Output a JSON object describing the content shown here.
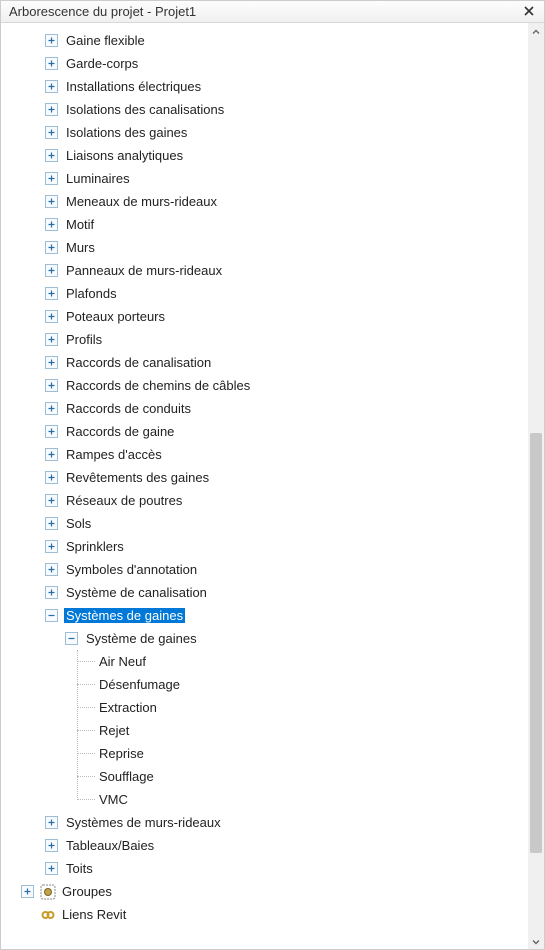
{
  "window": {
    "title": "Arborescence du projet - Projet1"
  },
  "tree": {
    "items": [
      {
        "label": "Gaine flexible",
        "depth": 2,
        "expander": "plus"
      },
      {
        "label": "Garde-corps",
        "depth": 2,
        "expander": "plus"
      },
      {
        "label": "Installations électriques",
        "depth": 2,
        "expander": "plus"
      },
      {
        "label": "Isolations des canalisations",
        "depth": 2,
        "expander": "plus"
      },
      {
        "label": "Isolations des gaines",
        "depth": 2,
        "expander": "plus"
      },
      {
        "label": "Liaisons analytiques",
        "depth": 2,
        "expander": "plus"
      },
      {
        "label": "Luminaires",
        "depth": 2,
        "expander": "plus"
      },
      {
        "label": "Meneaux de murs-rideaux",
        "depth": 2,
        "expander": "plus"
      },
      {
        "label": "Motif",
        "depth": 2,
        "expander": "plus"
      },
      {
        "label": "Murs",
        "depth": 2,
        "expander": "plus"
      },
      {
        "label": "Panneaux de murs-rideaux",
        "depth": 2,
        "expander": "plus"
      },
      {
        "label": "Plafonds",
        "depth": 2,
        "expander": "plus"
      },
      {
        "label": "Poteaux porteurs",
        "depth": 2,
        "expander": "plus"
      },
      {
        "label": "Profils",
        "depth": 2,
        "expander": "plus"
      },
      {
        "label": "Raccords de canalisation",
        "depth": 2,
        "expander": "plus"
      },
      {
        "label": "Raccords de chemins de câbles",
        "depth": 2,
        "expander": "plus"
      },
      {
        "label": "Raccords de conduits",
        "depth": 2,
        "expander": "plus"
      },
      {
        "label": "Raccords de gaine",
        "depth": 2,
        "expander": "plus"
      },
      {
        "label": "Rampes d'accès",
        "depth": 2,
        "expander": "plus"
      },
      {
        "label": "Revêtements des gaines",
        "depth": 2,
        "expander": "plus"
      },
      {
        "label": "Réseaux de poutres",
        "depth": 2,
        "expander": "plus"
      },
      {
        "label": "Sols",
        "depth": 2,
        "expander": "plus"
      },
      {
        "label": "Sprinklers",
        "depth": 2,
        "expander": "plus"
      },
      {
        "label": "Symboles d'annotation",
        "depth": 2,
        "expander": "plus"
      },
      {
        "label": "Système de canalisation",
        "depth": 2,
        "expander": "plus"
      },
      {
        "label": "Systèmes de gaines",
        "depth": 2,
        "expander": "minus",
        "selected": true
      },
      {
        "label": "Système de gaines",
        "depth": 3,
        "expander": "minus"
      },
      {
        "label": "Air Neuf",
        "depth": 4,
        "expander": "none"
      },
      {
        "label": "Désenfumage",
        "depth": 4,
        "expander": "none"
      },
      {
        "label": "Extraction",
        "depth": 4,
        "expander": "none"
      },
      {
        "label": "Rejet",
        "depth": 4,
        "expander": "none"
      },
      {
        "label": "Reprise",
        "depth": 4,
        "expander": "none"
      },
      {
        "label": "Soufflage",
        "depth": 4,
        "expander": "none"
      },
      {
        "label": "VMC",
        "depth": 4,
        "expander": "none"
      },
      {
        "label": "Systèmes de murs-rideaux",
        "depth": 2,
        "expander": "plus"
      },
      {
        "label": "Tableaux/Baies",
        "depth": 2,
        "expander": "plus"
      },
      {
        "label": "Toits",
        "depth": 2,
        "expander": "plus"
      },
      {
        "label": "Groupes",
        "depth": 1,
        "expander": "plus",
        "icon": "groups"
      },
      {
        "label": "Liens Revit",
        "depth": 1,
        "expander": "none",
        "icon": "revit-links"
      }
    ]
  }
}
